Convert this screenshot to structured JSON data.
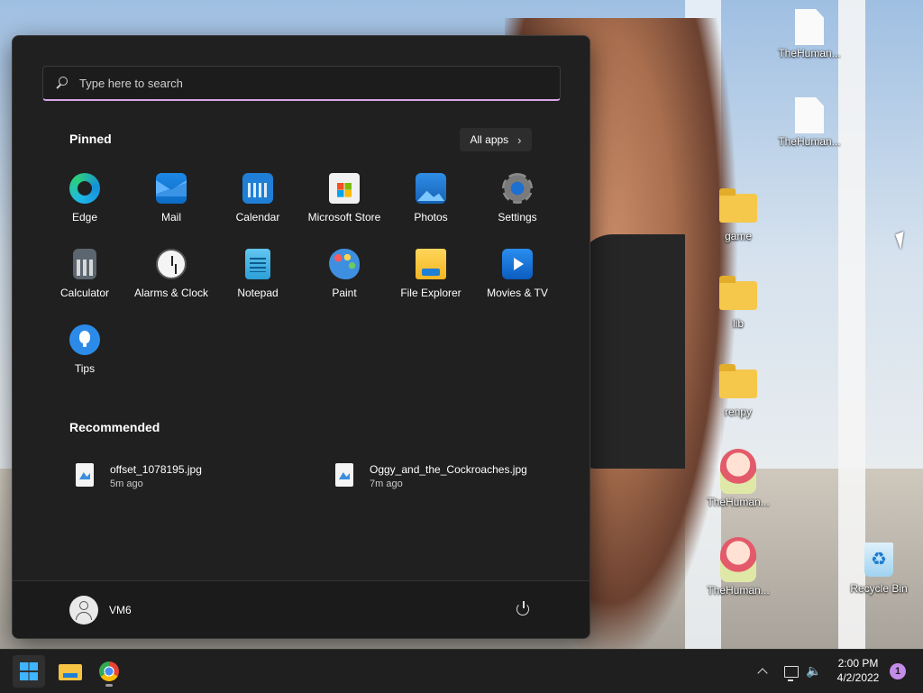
{
  "desktop": {
    "icons": [
      {
        "label": "TheHuman...",
        "type": "document"
      },
      {
        "label": "TheHuman...",
        "type": "document"
      },
      {
        "label": "game",
        "type": "folder"
      },
      {
        "label": "lib",
        "type": "folder"
      },
      {
        "label": "renpy",
        "type": "folder"
      },
      {
        "label": "TheHuman...",
        "type": "anime-app"
      },
      {
        "label": "TheHuman...",
        "type": "anime-app"
      },
      {
        "label": "Recycle Bin",
        "type": "recycle-bin"
      }
    ]
  },
  "start_menu": {
    "search_placeholder": "Type here to search",
    "pinned_title": "Pinned",
    "all_apps_label": "All apps",
    "pinned": [
      {
        "label": "Edge",
        "icon": "edge-icon"
      },
      {
        "label": "Mail",
        "icon": "mail-icon"
      },
      {
        "label": "Calendar",
        "icon": "calendar-icon"
      },
      {
        "label": "Microsoft Store",
        "icon": "store-icon"
      },
      {
        "label": "Photos",
        "icon": "photos-icon"
      },
      {
        "label": "Settings",
        "icon": "gear-icon"
      },
      {
        "label": "Calculator",
        "icon": "calculator-icon"
      },
      {
        "label": "Alarms & Clock",
        "icon": "clock-icon"
      },
      {
        "label": "Notepad",
        "icon": "notepad-icon"
      },
      {
        "label": "Paint",
        "icon": "paint-palette-icon"
      },
      {
        "label": "File Explorer",
        "icon": "folder-icon"
      },
      {
        "label": "Movies & TV",
        "icon": "play-icon"
      },
      {
        "label": "Tips",
        "icon": "lightbulb-icon"
      }
    ],
    "recommended_title": "Recommended",
    "recommended": [
      {
        "name": "offset_1078195.jpg",
        "time": "5m ago"
      },
      {
        "name": "Oggy_and_the_Cockroaches.jpg",
        "time": "7m ago"
      }
    ],
    "user_name": "VM6"
  },
  "taskbar": {
    "time": "2:00 PM",
    "date": "4/2/2022",
    "notification_count": "1"
  },
  "colors": {
    "start_bg": "#202020",
    "accent_underline": "#d7a6e6",
    "windows_blue": "#3fb4ff"
  }
}
